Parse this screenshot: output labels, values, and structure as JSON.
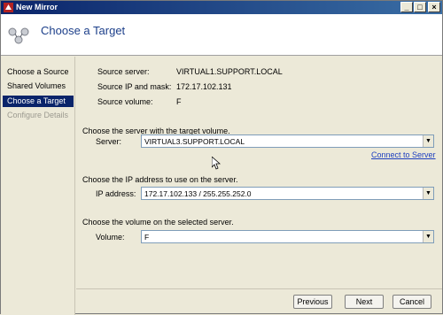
{
  "window": {
    "title": "New Mirror"
  },
  "header": {
    "title": "Choose a Target"
  },
  "nav": {
    "items": [
      {
        "label": "Choose a Source"
      },
      {
        "label": "Shared Volumes"
      },
      {
        "label": "Choose a Target"
      },
      {
        "label": "Configure Details"
      }
    ]
  },
  "source": {
    "server_label": "Source server:",
    "server_value": "VIRTUAL1.SUPPORT.LOCAL",
    "ip_label": "Source IP and mask:",
    "ip_value": "172.17.102.131",
    "volume_label": "Source volume:",
    "volume_value": "F"
  },
  "target_server": {
    "section_title": "Choose the server with the target volume.",
    "label": "Server:",
    "value": "VIRTUAL3.SUPPORT.LOCAL",
    "connect_link": "Connect to Server"
  },
  "ip": {
    "section_title": "Choose the IP address to use on the server.",
    "label": "IP address:",
    "value": "172.17.102.133 / 255.255.252.0"
  },
  "volume": {
    "section_title": "Choose the volume on the selected server.",
    "label": "Volume:",
    "value": "F"
  },
  "footer": {
    "previous": "Previous",
    "next": "Next",
    "cancel": "Cancel"
  }
}
